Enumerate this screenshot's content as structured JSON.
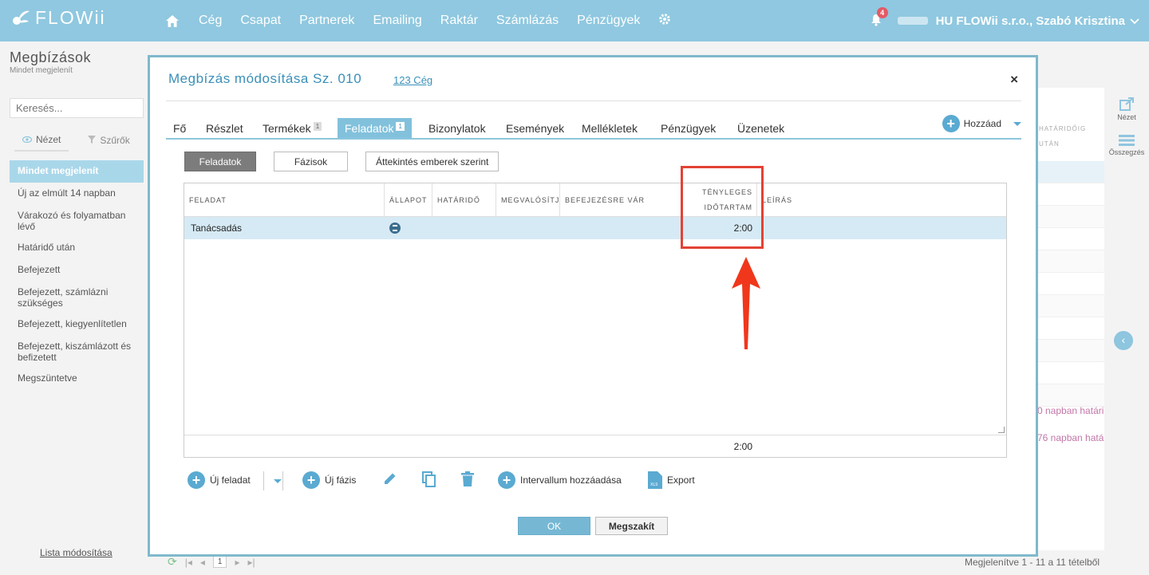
{
  "brand": {
    "name": "FLOWii",
    "accent": "#8fc8e0"
  },
  "nav": {
    "items": [
      "Cég",
      "Csapat",
      "Partnerek",
      "Emailing",
      "Raktár",
      "Számlázás",
      "Pénzügyek"
    ],
    "home_icon": "home-icon",
    "settings_icon": "gear-icon"
  },
  "user": {
    "notification_count": "4",
    "label": "HU FLOWii s.r.o., Szabó Krisztina"
  },
  "sidebar": {
    "title": "Megbízások",
    "subtitle": "Mindet megjelenít",
    "search_placeholder": "Keresés...",
    "view_tab": "Nézet",
    "filter_tab": "Szűrők",
    "items": [
      "Mindet megjelenít",
      "Új az elmúlt 14 napban",
      "Várakozó és folyamatban lévő",
      "Határidő után",
      "Befejezett",
      "Befejezett, számlázni szükséges",
      "Befejezett, kiegyenlítetlen",
      "Befejezett, kiszámlázott és befizetett",
      "Megszüntetve"
    ],
    "footer_link": "Lista módosítása"
  },
  "background": {
    "col_header_1": "HATÁRIDŐIG",
    "col_header_2": "UTÁN",
    "pink_1": "0 napban határi",
    "pink_2": "76 napban hatá",
    "rail_view": "Nézet",
    "rail_summary": "Összegzés",
    "page_number": "1",
    "records": "Megjelenítve 1 - 11 a 11 tételből"
  },
  "modal": {
    "title": "Megbízás módosítása Sz. 010",
    "company_link": "123 Cég",
    "close": "×",
    "tabs": [
      {
        "label": "Fő"
      },
      {
        "label": "Részlet"
      },
      {
        "label": "Termékek",
        "count": "1"
      },
      {
        "label": "Feladatok",
        "count": "1"
      },
      {
        "label": "Bizonylatok"
      },
      {
        "label": "Események"
      },
      {
        "label": "Mellékletek"
      },
      {
        "label": "Pénzügyek"
      },
      {
        "label": "Üzenetek"
      }
    ],
    "add_label": "Hozzáad",
    "subtabs": [
      "Feladatok",
      "Fázisok",
      "Áttekintés emberek szerint"
    ],
    "grid": {
      "headers": {
        "task": "FELADAT",
        "status": "ÁLLAPOT",
        "deadline": "HATÁRIDŐ",
        "assignee": "MEGVALÓSÍTJA",
        "waiting": "BEFEJEZÉSRE VÁR",
        "actual_duration_1": "TÉNYLEGES",
        "actual_duration_2": "IDŐTARTAM",
        "description": "LEÍRÁS"
      },
      "rows": [
        {
          "task": "Tanácsadás",
          "duration": "2:00"
        }
      ],
      "total_duration": "2:00"
    },
    "actions": {
      "new_task": "Új feladat",
      "new_phase": "Új fázis",
      "add_interval": "Intervallum hozzáadása",
      "export": "Export"
    },
    "ok": "OK",
    "cancel": "Megszakít"
  }
}
